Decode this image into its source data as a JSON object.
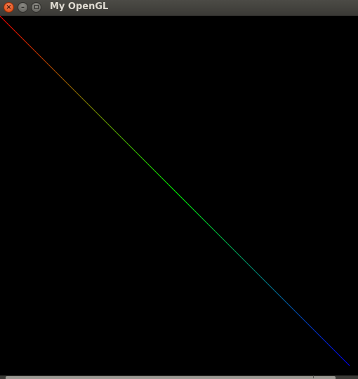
{
  "window": {
    "title": "My OpenGL",
    "close_glyph": "×",
    "minimize_glyph": "–",
    "maximize_icon": "maximize-icon"
  },
  "scene": {
    "background": "#000000",
    "line": {
      "start_color": "#ff0000",
      "mid_color": "#00ff00",
      "end_color": "#0000ff"
    }
  },
  "colors": {
    "titlebar": "#3e3d39",
    "close_button": "#e2541d",
    "title_text": "#dfdbd2"
  }
}
